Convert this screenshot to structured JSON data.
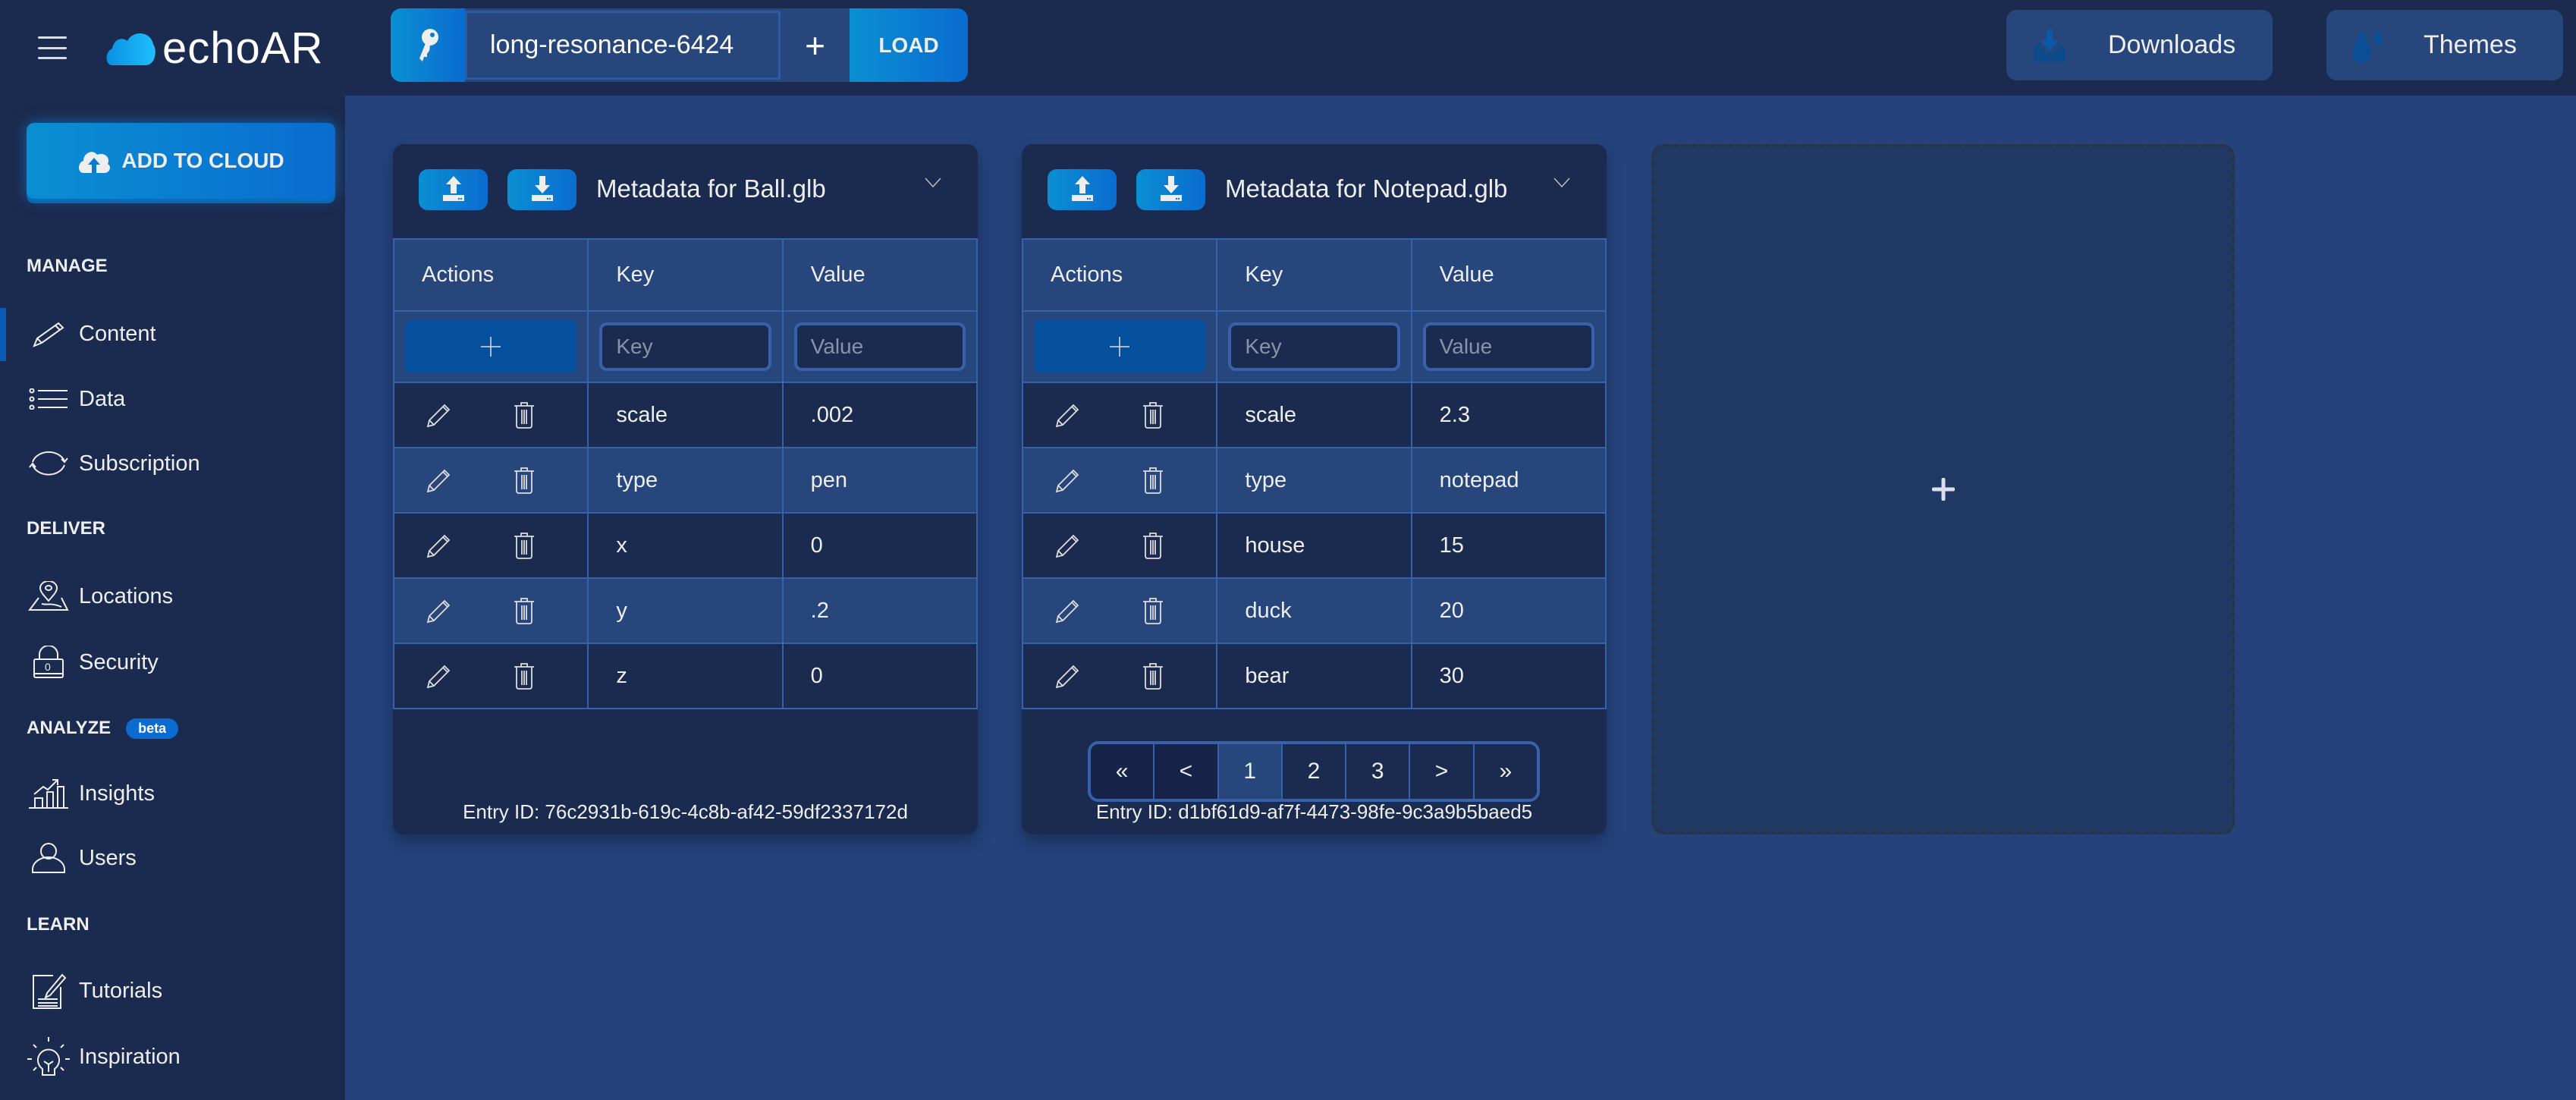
{
  "app": {
    "logo_text": "echoAR",
    "accent": "#0a6cd0",
    "background": "#25427a",
    "panel": "#1b2b4f"
  },
  "topbar": {
    "api_key": "long-resonance-6424",
    "plus_label": "+",
    "load_label": "LOAD",
    "downloads_label": "Downloads",
    "themes_label": "Themes"
  },
  "sidebar": {
    "add_to_cloud_label": "ADD TO CLOUD",
    "sections": {
      "manage": "MANAGE",
      "deliver": "DELIVER",
      "analyze": "ANALYZE",
      "analyze_badge": "beta",
      "learn": "LEARN"
    },
    "items": [
      {
        "label": "Content",
        "icon": "pencil-icon",
        "active": true
      },
      {
        "label": "Data",
        "icon": "list-icon"
      },
      {
        "label": "Subscription",
        "icon": "refresh-icon"
      },
      {
        "label": "Locations",
        "icon": "map-pin-icon"
      },
      {
        "label": "Security",
        "icon": "lock-icon"
      },
      {
        "label": "Insights",
        "icon": "chart-icon"
      },
      {
        "label": "Users",
        "icon": "user-icon"
      },
      {
        "label": "Tutorials",
        "icon": "notebook-icon"
      },
      {
        "label": "Inspiration",
        "icon": "lightbulb-icon"
      }
    ]
  },
  "cards": [
    {
      "title": "Metadata for Ball.glb",
      "columns": [
        "Actions",
        "Key",
        "Value"
      ],
      "key_placeholder": "Key",
      "value_placeholder": "Value",
      "rows": [
        {
          "key": "scale",
          "value": ".002"
        },
        {
          "key": "type",
          "value": "pen"
        },
        {
          "key": "x",
          "value": "0"
        },
        {
          "key": "y",
          "value": ".2"
        },
        {
          "key": "z",
          "value": "0"
        }
      ],
      "entry_id": "Entry ID: 76c2931b-619c-4c8b-af42-59df2337172d"
    },
    {
      "title": "Metadata for Notepad.glb",
      "columns": [
        "Actions",
        "Key",
        "Value"
      ],
      "key_placeholder": "Key",
      "value_placeholder": "Value",
      "rows": [
        {
          "key": "scale",
          "value": "2.3"
        },
        {
          "key": "type",
          "value": "notepad"
        },
        {
          "key": "house",
          "value": "15"
        },
        {
          "key": "duck",
          "value": "20"
        },
        {
          "key": "bear",
          "value": "30"
        }
      ],
      "pagination": {
        "first": "«",
        "prev": "<",
        "pages": [
          "1",
          "2",
          "3"
        ],
        "current": "1",
        "next": ">",
        "last": "»"
      },
      "entry_id": "Entry ID: d1bf61d9-af7f-4473-98fe-9c3a9b5baed5"
    }
  ]
}
